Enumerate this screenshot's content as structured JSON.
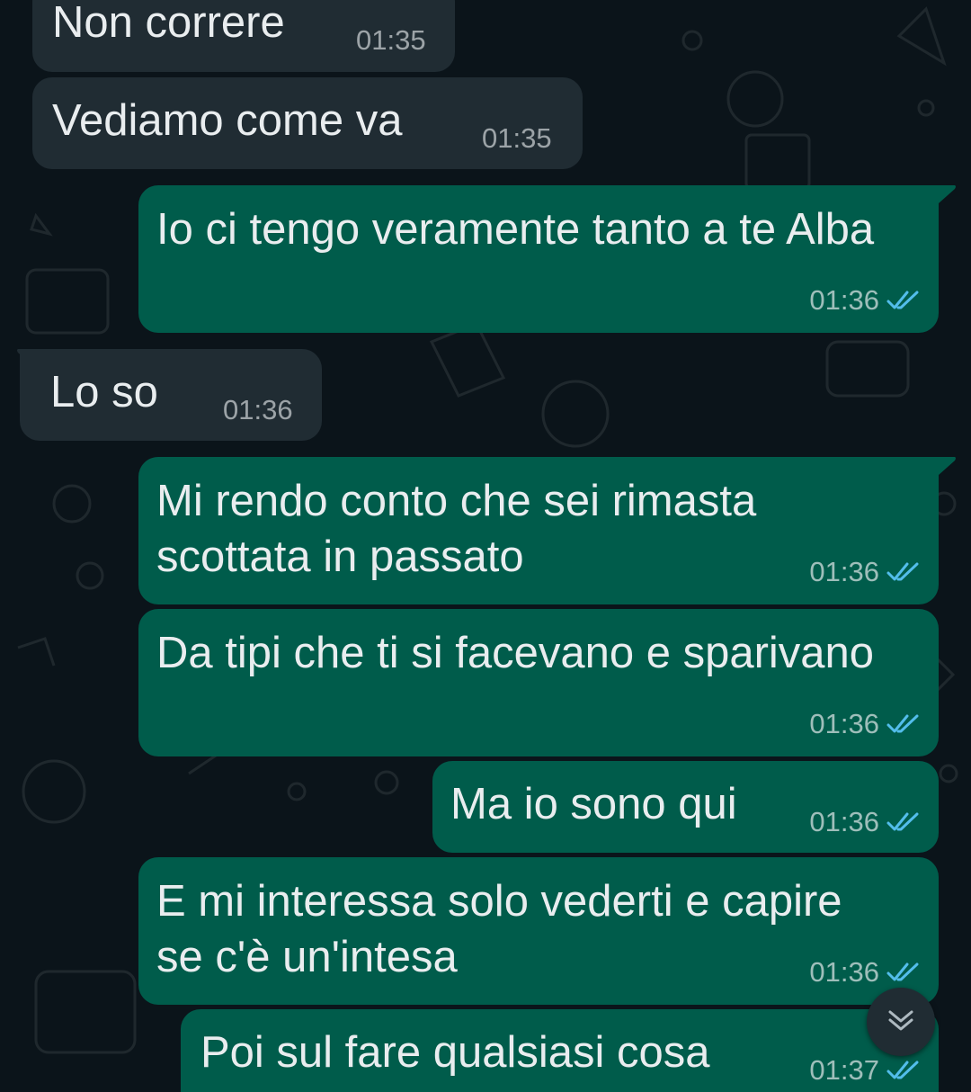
{
  "colors": {
    "background": "#0b141a",
    "incoming_bubble": "#202c33",
    "outgoing_bubble": "#005c4b",
    "read_tick": "#53bdeb",
    "text": "#e9edef"
  },
  "messages": [
    {
      "direction": "incoming",
      "text": "Non correre",
      "time": "01:35"
    },
    {
      "direction": "incoming",
      "text": "Vediamo come va",
      "time": "01:35"
    },
    {
      "direction": "outgoing",
      "text": "Io ci tengo veramente tanto a te Alba",
      "time": "01:36",
      "status": "read"
    },
    {
      "direction": "incoming",
      "text": "Lo so",
      "time": "01:36"
    },
    {
      "direction": "outgoing",
      "text": "Mi rendo conto che sei rimasta\nscottata in passato",
      "time": "01:36",
      "status": "read"
    },
    {
      "direction": "outgoing",
      "text": "Da tipi che ti si facevano e sparivano",
      "time": "01:36",
      "status": "read"
    },
    {
      "direction": "outgoing",
      "text": "Ma io sono qui",
      "time": "01:36",
      "status": "read"
    },
    {
      "direction": "outgoing",
      "text": "E mi interessa solo vederti e capire\nse c'è un'intesa",
      "time": "01:36",
      "status": "read"
    },
    {
      "direction": "outgoing",
      "text": "Poi sul fare qualsiasi cosa",
      "time": "01:37",
      "status": "read"
    }
  ],
  "icons": {
    "read_receipt": "double-check-icon",
    "scroll_down": "chevron-double-down-icon"
  }
}
